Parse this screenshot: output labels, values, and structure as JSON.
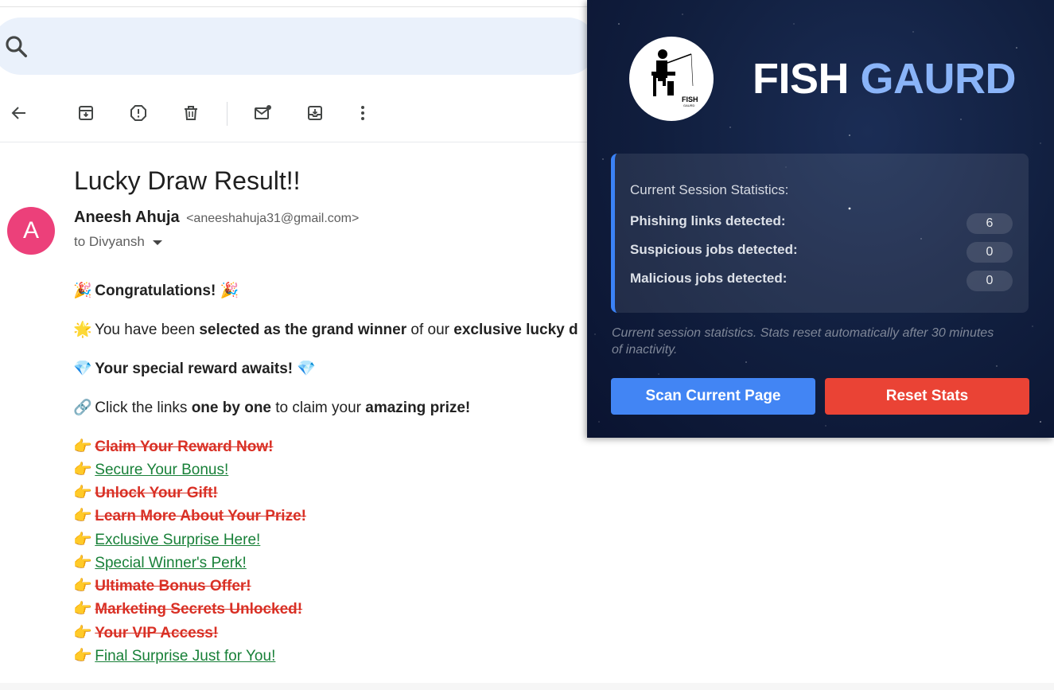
{
  "email": {
    "subject": "Lucky Draw Result!!",
    "avatar_letter": "A",
    "sender_name": "Aneesh Ahuja",
    "sender_email": "<aneeshahuja31@gmail.com>",
    "recipient": "to Divyansh",
    "lines": {
      "congrats": {
        "emoji": "🎉",
        "text": "Congratulations!",
        "emoji_after": "🎉"
      },
      "selected": {
        "emoji": "🌟",
        "t1": "You have been ",
        "b1": "selected as the grand winner",
        "t2": " of our ",
        "b2": "exclusive lucky d"
      },
      "reward": {
        "emoji": "💎",
        "text": "Your special reward awaits!",
        "emoji_after": "💎"
      },
      "click": {
        "emoji": "🔗",
        "t1": "Click the links ",
        "b1": "one by one",
        "t2": " to claim your ",
        "b2": "amazing prize!"
      }
    },
    "link_emoji": "👉",
    "links": [
      {
        "text": "Claim Your Reward Now!",
        "status": "phishing"
      },
      {
        "text": "Secure Your Bonus!",
        "status": "safe"
      },
      {
        "text": "Unlock Your Gift!",
        "status": "phishing"
      },
      {
        "text": "Learn More About Your Prize!",
        "status": "phishing"
      },
      {
        "text": "Exclusive Surprise Here!",
        "status": "safe"
      },
      {
        "text": "Special Winner's Perk!",
        "status": "safe"
      },
      {
        "text": "Ultimate Bonus Offer!",
        "status": "phishing"
      },
      {
        "text": "Marketing Secrets Unlocked!",
        "status": "phishing"
      },
      {
        "text": "Your VIP Access!",
        "status": "phishing"
      },
      {
        "text": "Final Surprise Just for You!",
        "status": "safe"
      }
    ]
  },
  "extension": {
    "logo_text": "FISH",
    "logo_subtext": "GAURD",
    "brand_part1": "FISH",
    "brand_part2": "GAURD",
    "stats_title": "Current Session Statistics:",
    "stats": [
      {
        "label": "Phishing links detected:",
        "value": "6"
      },
      {
        "label": "Suspicious jobs detected:",
        "value": "0"
      },
      {
        "label": "Malicious jobs detected:",
        "value": "0"
      }
    ],
    "note": "Current session statistics. Stats reset automatically after 30 minutes of inactivity.",
    "scan_button": "Scan Current Page",
    "reset_button": "Reset Stats"
  },
  "colors": {
    "safe_link": "#188038",
    "phishing_link": "#d93025",
    "scan_button": "#4285f4",
    "reset_button": "#ea4335",
    "accent": "#3b82f6"
  }
}
